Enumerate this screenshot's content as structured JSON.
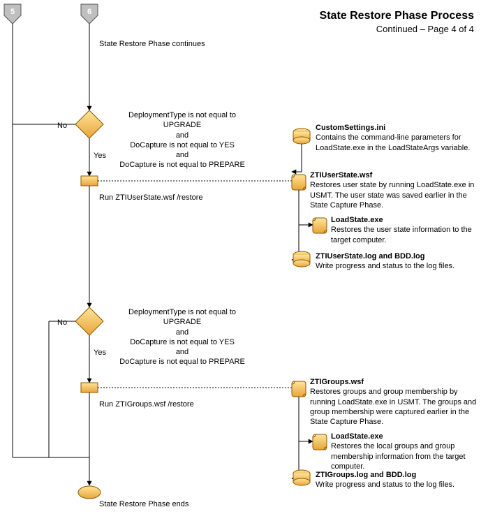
{
  "title": "State Restore Phase Process",
  "subtitle": "Continued – Page 4 of 4",
  "connector5": "5",
  "connector6": "6",
  "start_label": "State Restore Phase continues",
  "decision1": {
    "line1": "DeploymentType is not equal to UPGRADE",
    "line2": "and",
    "line3": "DoCapture is not equal to YES",
    "line4": "and",
    "line5": "DoCapture is not equal to PREPARE",
    "no": "No",
    "yes": "Yes"
  },
  "process1": "Run ZTIUserState.wsf /restore",
  "decision2": {
    "line1": "DeploymentType is not equal to UPGRADE",
    "line2": "and",
    "line3": "DoCapture is not equal to YES",
    "line4": "and",
    "line5": "DoCapture is not equal to PREPARE",
    "no": "No",
    "yes": "Yes"
  },
  "process2": "Run ZTIGroups.wsf /restore",
  "end_label": "State Restore Phase ends",
  "refs": {
    "custom": {
      "title": "CustomSettings.ini",
      "desc": "Contains the command-line parameters for LoadState.exe in the LoadStateArgs variable."
    },
    "ztiuser": {
      "title": "ZTIUserState.wsf",
      "desc": "Restores user state by running LoadState.exe in USMT. The user state was saved earlier in the State Capture Phase."
    },
    "loadstate1": {
      "title": "LoadState.exe",
      "desc": "Restores the user state information to the target computer."
    },
    "ztiuserlog": {
      "title": "ZTIUserState.log and BDD.log",
      "desc": "Write progress and status to the log files."
    },
    "ztigroups": {
      "title": "ZTIGroups.wsf",
      "desc": "Restores groups and group membership by running LoadState.exe in USMT. The groups and group membership were captured earlier in the State Capture Phase."
    },
    "loadstate2": {
      "title": "LoadState.exe",
      "desc": "Restores the local groups and group membership information from the target computer."
    },
    "ztigroupslog": {
      "title": "ZTIGroups.log and BDD.log",
      "desc": "Write progress and status to the log files."
    }
  },
  "chart_data": {
    "type": "flowchart",
    "title": "State Restore Phase Process (Page 4 of 4)",
    "nodes": [
      {
        "id": "c5",
        "type": "offpage-connector",
        "label": "5"
      },
      {
        "id": "c6",
        "type": "offpage-connector",
        "label": "6"
      },
      {
        "id": "start",
        "type": "label",
        "text": "State Restore Phase continues"
      },
      {
        "id": "d1",
        "type": "decision",
        "text": "DeploymentType is not equal to UPGRADE and DoCapture is not equal to YES and DoCapture is not equal to PREPARE"
      },
      {
        "id": "p1",
        "type": "process",
        "text": "Run ZTIUserState.wsf /restore"
      },
      {
        "id": "d2",
        "type": "decision",
        "text": "DeploymentType is not equal to UPGRADE and DoCapture is not equal to YES and DoCapture is not equal to PREPARE"
      },
      {
        "id": "p2",
        "type": "process",
        "text": "Run ZTIGroups.wsf /restore"
      },
      {
        "id": "end",
        "type": "terminator",
        "text": "State Restore Phase ends"
      },
      {
        "id": "r_custom",
        "type": "datastore",
        "text": "CustomSettings.ini — Contains the command-line parameters for LoadState.exe in the LoadStateArgs variable."
      },
      {
        "id": "r_ztiuser",
        "type": "script",
        "text": "ZTIUserState.wsf — Restores user state by running LoadState.exe in USMT. The user state was saved earlier in the State Capture Phase."
      },
      {
        "id": "r_loadstate1",
        "type": "script",
        "text": "LoadState.exe — Restores the user state information to the target computer."
      },
      {
        "id": "r_ztiuserlog",
        "type": "datastore",
        "text": "ZTIUserState.log and BDD.log — Write progress and status to the log files."
      },
      {
        "id": "r_ztigroups",
        "type": "script",
        "text": "ZTIGroups.wsf — Restores groups and group membership by running LoadState.exe in USMT. The groups and group membership were captured earlier in the State Capture Phase."
      },
      {
        "id": "r_loadstate2",
        "type": "script",
        "text": "LoadState.exe — Restores the local groups and group membership information from the target computer."
      },
      {
        "id": "r_ztigroupslog",
        "type": "datastore",
        "text": "ZTIGroups.log and BDD.log — Write progress and status to the log files."
      }
    ],
    "edges": [
      {
        "from": "c6",
        "to": "d1"
      },
      {
        "from": "d1",
        "to": "p1",
        "label": "Yes"
      },
      {
        "from": "d1",
        "to": "end",
        "label": "No",
        "via": "c5-lane"
      },
      {
        "from": "p1",
        "to": "d2"
      },
      {
        "from": "d2",
        "to": "p2",
        "label": "Yes"
      },
      {
        "from": "d2",
        "to": "end",
        "label": "No",
        "via": "left-lane"
      },
      {
        "from": "p2",
        "to": "end"
      },
      {
        "from": "c5",
        "to": "end"
      },
      {
        "from": "p1",
        "to": "r_ztiuser",
        "style": "dotted"
      },
      {
        "from": "r_custom",
        "to": "r_ztiuser"
      },
      {
        "from": "r_ztiuser",
        "to": "r_loadstate1"
      },
      {
        "from": "r_ztiuser",
        "to": "r_ztiuserlog"
      },
      {
        "from": "p2",
        "to": "r_ztigroups",
        "style": "dotted"
      },
      {
        "from": "r_ztigroups",
        "to": "r_loadstate2"
      },
      {
        "from": "r_ztigroups",
        "to": "r_ztigroupslog"
      }
    ]
  }
}
